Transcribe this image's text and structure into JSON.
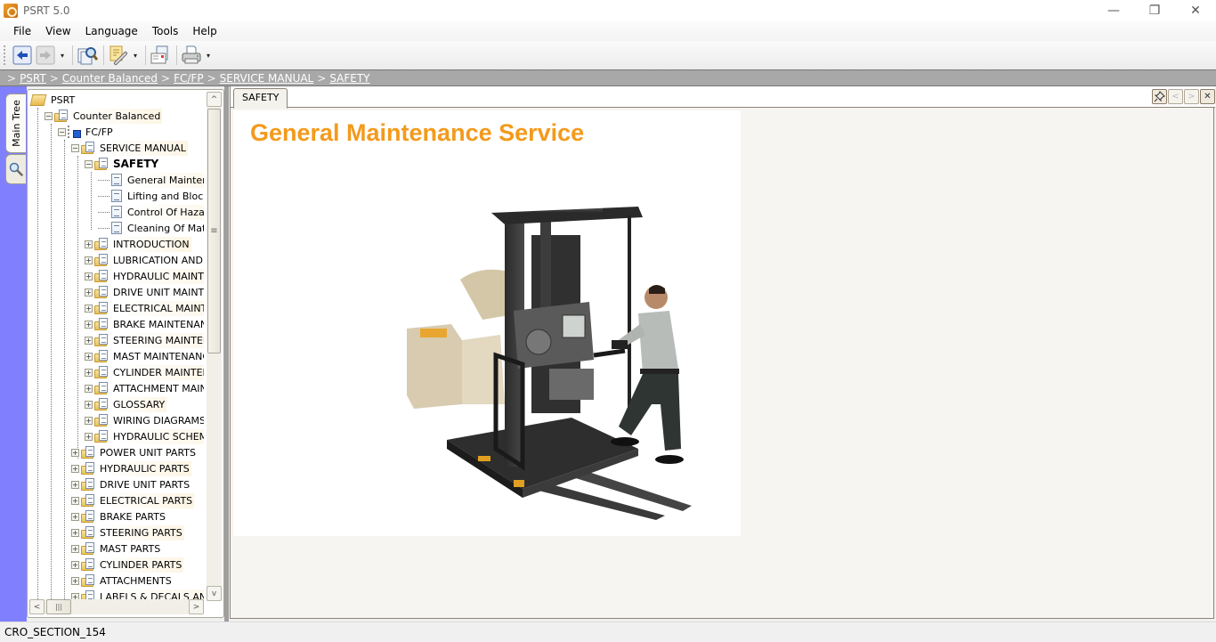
{
  "window": {
    "title": "PSRT 5.0",
    "controls": {
      "minimize": "—",
      "maximize": "❐",
      "close": "✕"
    }
  },
  "menu": [
    {
      "label": "File"
    },
    {
      "label": "View"
    },
    {
      "label": "Language"
    },
    {
      "label": "Tools"
    },
    {
      "label": "Help"
    }
  ],
  "toolbar": {
    "buttons": [
      {
        "name": "back",
        "icon": "back-arrow-icon"
      },
      {
        "name": "forward",
        "icon": "forward-arrow-icon",
        "disabled": true
      },
      {
        "name": "search",
        "icon": "find-document-icon"
      },
      {
        "name": "link",
        "icon": "link-notes-icon"
      },
      {
        "name": "email",
        "icon": "email-document-icon"
      },
      {
        "name": "print",
        "icon": "printer-icon"
      }
    ],
    "dropdown_glyph": "▾"
  },
  "breadcrumb": {
    "prefix": ">",
    "separator": ">",
    "items": [
      "PSRT",
      "Counter Balanced",
      "FC/FP",
      "SERVICE MANUAL",
      "SAFETY"
    ]
  },
  "side_tabs": {
    "main_tree": "Main Tree",
    "search_icon": "magnifier-icon"
  },
  "tree": {
    "rows": [
      {
        "label": "PSRT",
        "level": 0,
        "icon": "open-folder",
        "expander": ""
      },
      {
        "label": "Counter Balanced",
        "level": 1,
        "icon": "folder-doc",
        "expander": "−"
      },
      {
        "label": "FC/FP",
        "level": 2,
        "icon": "tree-node",
        "expander": "−"
      },
      {
        "label": "SERVICE MANUAL",
        "level": 3,
        "icon": "folder-doc",
        "expander": "−"
      },
      {
        "label": "SAFETY",
        "level": 4,
        "icon": "folder-doc",
        "expander": "−",
        "selected": true
      },
      {
        "label": "General Maintenance",
        "level": 5,
        "icon": "doc",
        "expander": ""
      },
      {
        "label": "Lifting and Blocking (N",
        "level": 5,
        "icon": "doc",
        "expander": ""
      },
      {
        "label": "Control Of Hazardous",
        "level": 5,
        "icon": "doc",
        "expander": ""
      },
      {
        "label": "Cleaning Of Material I",
        "level": 5,
        "icon": "doc",
        "expander": ""
      },
      {
        "label": "INTRODUCTION",
        "level": 4,
        "icon": "folder-doc",
        "expander": "+"
      },
      {
        "label": "LUBRICATION AND ADJU",
        "level": 4,
        "icon": "folder-doc",
        "expander": "+"
      },
      {
        "label": "HYDRAULIC MAINTENAN",
        "level": 4,
        "icon": "folder-doc",
        "expander": "+"
      },
      {
        "label": "DRIVE UNIT MAINTENAN",
        "level": 4,
        "icon": "folder-doc",
        "expander": "+"
      },
      {
        "label": "ELECTRICAL MAINTENAI",
        "level": 4,
        "icon": "folder-doc",
        "expander": "+"
      },
      {
        "label": "BRAKE MAINTENANCE",
        "level": 4,
        "icon": "folder-doc",
        "expander": "+"
      },
      {
        "label": "STEERING MAINTENANC",
        "level": 4,
        "icon": "folder-doc",
        "expander": "+"
      },
      {
        "label": "MAST MAINTENANCE",
        "level": 4,
        "icon": "folder-doc",
        "expander": "+"
      },
      {
        "label": "CYLINDER MAINTENANC",
        "level": 4,
        "icon": "folder-doc",
        "expander": "+"
      },
      {
        "label": "ATTACHMENT MAINTEN/",
        "level": 4,
        "icon": "folder-doc",
        "expander": "+"
      },
      {
        "label": "GLOSSARY",
        "level": 4,
        "icon": "folder-doc",
        "expander": "+"
      },
      {
        "label": "WIRING DIAGRAMS",
        "level": 4,
        "icon": "folder-doc",
        "expander": "+"
      },
      {
        "label": "HYDRAULIC SCHEMATIC",
        "level": 4,
        "icon": "folder-doc",
        "expander": "+"
      },
      {
        "label": "POWER UNIT PARTS",
        "level": 3,
        "icon": "folder-doc",
        "expander": "+"
      },
      {
        "label": "HYDRAULIC PARTS",
        "level": 3,
        "icon": "folder-doc",
        "expander": "+"
      },
      {
        "label": "DRIVE UNIT PARTS",
        "level": 3,
        "icon": "folder-doc",
        "expander": "+"
      },
      {
        "label": "ELECTRICAL PARTS",
        "level": 3,
        "icon": "folder-doc",
        "expander": "+"
      },
      {
        "label": "BRAKE PARTS",
        "level": 3,
        "icon": "folder-doc",
        "expander": "+"
      },
      {
        "label": "STEERING PARTS",
        "level": 3,
        "icon": "folder-doc",
        "expander": "+"
      },
      {
        "label": "MAST PARTS",
        "level": 3,
        "icon": "folder-doc",
        "expander": "+"
      },
      {
        "label": "CYLINDER PARTS",
        "level": 3,
        "icon": "folder-doc",
        "expander": "+"
      },
      {
        "label": "ATTACHMENTS",
        "level": 3,
        "icon": "folder-doc",
        "expander": "+"
      },
      {
        "label": "LABELS & DECALS AND ACC",
        "level": 3,
        "icon": "folder-doc",
        "expander": "+"
      }
    ],
    "scroll": {
      "up": "^",
      "down": "v",
      "left": "<",
      "right": ">",
      "thumb_grip": "≡",
      "hthumb_grip": "|||"
    }
  },
  "content": {
    "tab_label": "SAFETY",
    "tab_controls": {
      "pin": "pin-icon",
      "prev": "<",
      "next": ">",
      "close": "✕"
    },
    "document": {
      "title": "General Maintenance Service",
      "image": "order-picker-forklift-with-operator-illustration"
    }
  },
  "colors": {
    "title_orange": "#f39a1c",
    "selection": "#c3c3f6",
    "breadcrumb_bg": "#a8a8a8",
    "side_strip": "#8080ff"
  },
  "status": {
    "text": "CRO_SECTION_154"
  }
}
